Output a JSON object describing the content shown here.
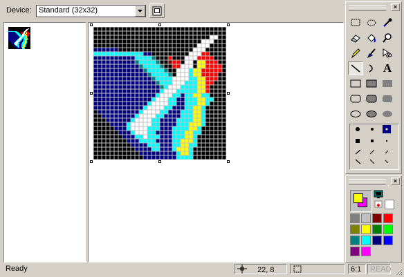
{
  "device_bar": {
    "label": "Device:",
    "selected": "Standard (32x32)",
    "new_device_icon": "new-device-image-icon"
  },
  "status": {
    "text": "Ready",
    "cursor_pos": "22, 8",
    "zoom": "6:1",
    "read_indicator": "READ"
  },
  "tools": [
    {
      "name": "rectangle-select-tool",
      "icon": "dotted-rectangle-icon",
      "active": false
    },
    {
      "name": "free-form-select-tool",
      "icon": "dotted-lasso-icon",
      "active": false
    },
    {
      "name": "color-pick-tool",
      "icon": "eyedropper-icon",
      "active": false
    },
    {
      "name": "eraser-tool",
      "icon": "eraser-icon",
      "active": false
    },
    {
      "name": "fill-tool",
      "icon": "paint-bucket-icon",
      "active": false
    },
    {
      "name": "magnifier-tool",
      "icon": "magnifier-icon",
      "active": false
    },
    {
      "name": "pencil-tool",
      "icon": "pencil-icon",
      "active": false
    },
    {
      "name": "brush-tool",
      "icon": "brush-icon",
      "active": false
    },
    {
      "name": "hotspot-tool",
      "icon": "hotspot-icon",
      "active": false
    },
    {
      "name": "line-tool",
      "icon": "line-icon",
      "active": true
    },
    {
      "name": "curve-tool",
      "icon": "curve-icon",
      "active": false
    },
    {
      "name": "text-tool",
      "icon": "text-icon",
      "active": false
    },
    {
      "name": "rectangle-tool",
      "icon": "rectangle-outline-icon",
      "active": false
    },
    {
      "name": "filled-rectangle-border-tool",
      "icon": "rectangle-filled-bordered-icon",
      "active": false
    },
    {
      "name": "filled-rectangle-tool",
      "icon": "rectangle-filled-icon",
      "active": false
    },
    {
      "name": "rounded-rectangle-tool",
      "icon": "rounded-rectangle-outline-icon",
      "active": false
    },
    {
      "name": "filled-rounded-rectangle-border-tool",
      "icon": "rounded-rectangle-filled-bordered-icon",
      "active": false
    },
    {
      "name": "filled-rounded-rectangle-tool",
      "icon": "rounded-rectangle-filled-icon",
      "active": false
    },
    {
      "name": "ellipse-tool",
      "icon": "ellipse-outline-icon",
      "active": false
    },
    {
      "name": "filled-ellipse-border-tool",
      "icon": "ellipse-filled-bordered-icon",
      "active": false
    },
    {
      "name": "filled-ellipse-tool",
      "icon": "ellipse-filled-icon",
      "active": false
    }
  ],
  "text_tool_glyph": "A",
  "palette": {
    "foreground": "#ffff00",
    "background": "#ff00ff",
    "screen_color_icon": "screen-color-icon",
    "inverse_color_icon": "inverse-color-icon",
    "swatches": [
      "#808080",
      "#c0c0c0",
      "#800000",
      "#ff0000",
      "#808000",
      "#ffff00",
      "#008000",
      "#00ff00",
      "#008080",
      "#00ffff",
      "#000080",
      "#0000ff",
      "#800080",
      "#ff00ff"
    ]
  },
  "image": {
    "size": 32,
    "legend": {
      "k": "#000000",
      "b": "#000080",
      "B": "#0000ff",
      "c": "#00ffff",
      "t": "#008080",
      "w": "#ffffff",
      "y": "#ffff00",
      "r": "#ff0000",
      "m": "#800000",
      "g": "#c0c0c0"
    },
    "rows": [
      "kkkkkkkkkkkkkkkkkkkkkkkkkkkkkkkk",
      "kkkkkkkkkkkkkkkkkkkkkkkkkkkkkkkk",
      "kkkkkkkkkkkkkkkkkkkkkkkkkkkkwwkk",
      "kkkkkkkkkkkkkkkkkkkkkkkkkkwwwkkk",
      "kkkkkkkkkkkkkkkkkkkkkkkkkwwwkkkk",
      "bbbbbbkkkkkkkkkkkkkkkkkkwwwkkkkk",
      "ccccccccccccbbkkkkkkkkkwwwrrkkkk",
      "bbbbbbbbbbcccctkkkrkkkwwwrrrrkkk",
      "bbbbbbbbbbtcccctkkmrrkwwkyyrrrkk",
      "bbbbbbbbbbbtcccctkkrrwwwkyyrrrrk",
      "bbbbbbbbbbbbtcccctkkwwwcyyrrrrrk",
      "bbbbbbbbbbbbbtcccctkwwwcyyrrrrkk",
      "bbbbbbbbbbbbbbtccccwwwwccyyrrrkk",
      "bbbbbbbbbbbbbbbtcccwwwcccyyrrkkk",
      "bbbbbbbbbbbbbbbbtcwwwccccyyrkkkk",
      "bbbbbbbbbbbbbbbbcwwwcccccyyrkkkk",
      "bbbbbbbbbbbbbbbcwwwccbccyycckkkk",
      "bbbbbbbbbbbbbbcwwwccbbcccyycckkk",
      "bbbbbbbbbbbbbcwwwwccbbcccyyckkkk",
      "bbbbbbbbbbbbcwwwwccbbbccyyckkkkk",
      "kbbbbbbbbbbcwwwwccbbbcccyyckkkkk",
      "kkbbbbbbbbcwwwwccbbbbcccyyckkkkk",
      "kkkbbbbbbcwwwwccbbbbccccyyckkkkk",
      "kkkkbbbbcwwwwwccbbbbcccyyyckkkkk",
      "kkkkkbbbcwwwwcccbbbccccyyckkkkkk",
      "kkkkkkbbbcwwwccbbbbcccyycckkkkkk",
      "kkkkkkkbbbccwcccbbbcccyyckkkkkkk",
      "kkkkkkkkbbbccccbbbbccyyyckkkkkkk",
      "kkkkkkkkkbbbbcccbbbccyycckkkkkkk",
      "kkkkkkkkkkbbbbccbbbcyyyckkkkkkkk",
      "kkkkkkkkkkkbbbbbbbbbcyyckkkkkkkk",
      "kkkkkkkkkkkkbbbbbbbbcccckkkkkkkk"
    ]
  }
}
